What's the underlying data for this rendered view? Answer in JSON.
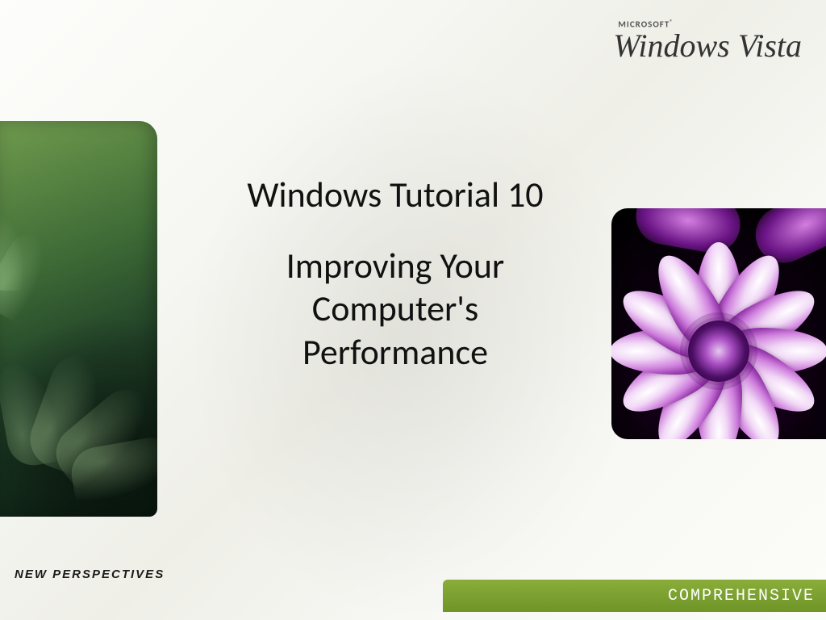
{
  "brand": {
    "small": "MICROSOFT",
    "reg": "®",
    "large": "Windows Vista"
  },
  "title": {
    "line1": "Windows Tutorial 10",
    "line2": "Improving Your",
    "line3": "Computer's",
    "line4": "Performance"
  },
  "tagline": "NEW PERSPECTIVES",
  "footer": "COMPREHENSIVE"
}
